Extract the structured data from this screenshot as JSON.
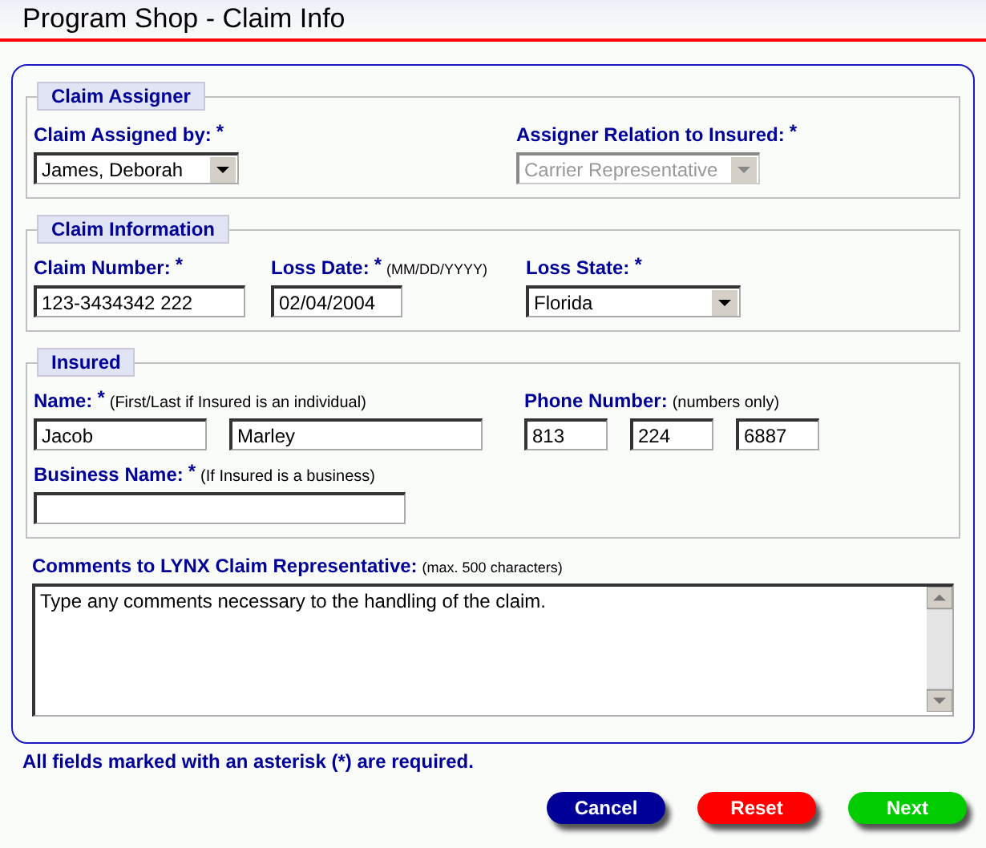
{
  "title": "Program Shop - Claim Info",
  "sections": [
    {
      "legend": "Claim Assigner",
      "rows": [
        {
          "fields": [
            {
              "kind": "select",
              "label": "Claim Assigned by:",
              "asterisk": "*",
              "values": [
                "James, Deborah"
              ],
              "disabled": false
            },
            {
              "kind": "select",
              "label": "Assigner Relation to Insured:",
              "asterisk": "*",
              "values": [
                "Carrier Representative"
              ],
              "disabled": true
            }
          ]
        }
      ]
    },
    {
      "legend": "Claim Information",
      "rows": [
        {
          "fields": [
            {
              "kind": "text",
              "label": "Claim Number:",
              "asterisk": "*",
              "values": [
                "123-3434342 222"
              ]
            },
            {
              "kind": "text",
              "label": "Loss Date:",
              "asterisk": "*",
              "hint": "(MM/DD/YYYY)",
              "values": [
                "02/04/2004"
              ]
            },
            {
              "kind": "select",
              "label": "Loss State:",
              "asterisk": "*",
              "values": [
                "Florida"
              ],
              "disabled": false
            }
          ]
        }
      ]
    },
    {
      "legend": "Insured",
      "rows": [
        {
          "fields": [
            {
              "kind": "text",
              "label": "Name:",
              "asterisk": "*",
              "hint": "(First/Last if Insured is an individual)",
              "values": [
                "Jacob",
                "Marley"
              ]
            },
            {
              "kind": "text",
              "label": "Phone Number:",
              "hint": "(numbers only)",
              "values": [
                "813",
                "224",
                "6887"
              ]
            }
          ]
        },
        {
          "fields": [
            {
              "kind": "blank",
              "label": "Business Name:",
              "asterisk": "*",
              "hint": "(If Insured is a business)"
            }
          ]
        }
      ]
    }
  ],
  "comments": {
    "label": "Comments to LYNX Claim Representative:",
    "hint": "(max. 500 characters)",
    "value": "Type any comments necessary to the handling of the claim."
  },
  "note": "All fields marked with an asterisk (*) are required.",
  "buttons": [
    {
      "label": "Cancel",
      "color": "#000099"
    },
    {
      "label": "Reset",
      "color": "#ff0000"
    },
    {
      "label": "Next",
      "color": "#00cc00"
    }
  ]
}
